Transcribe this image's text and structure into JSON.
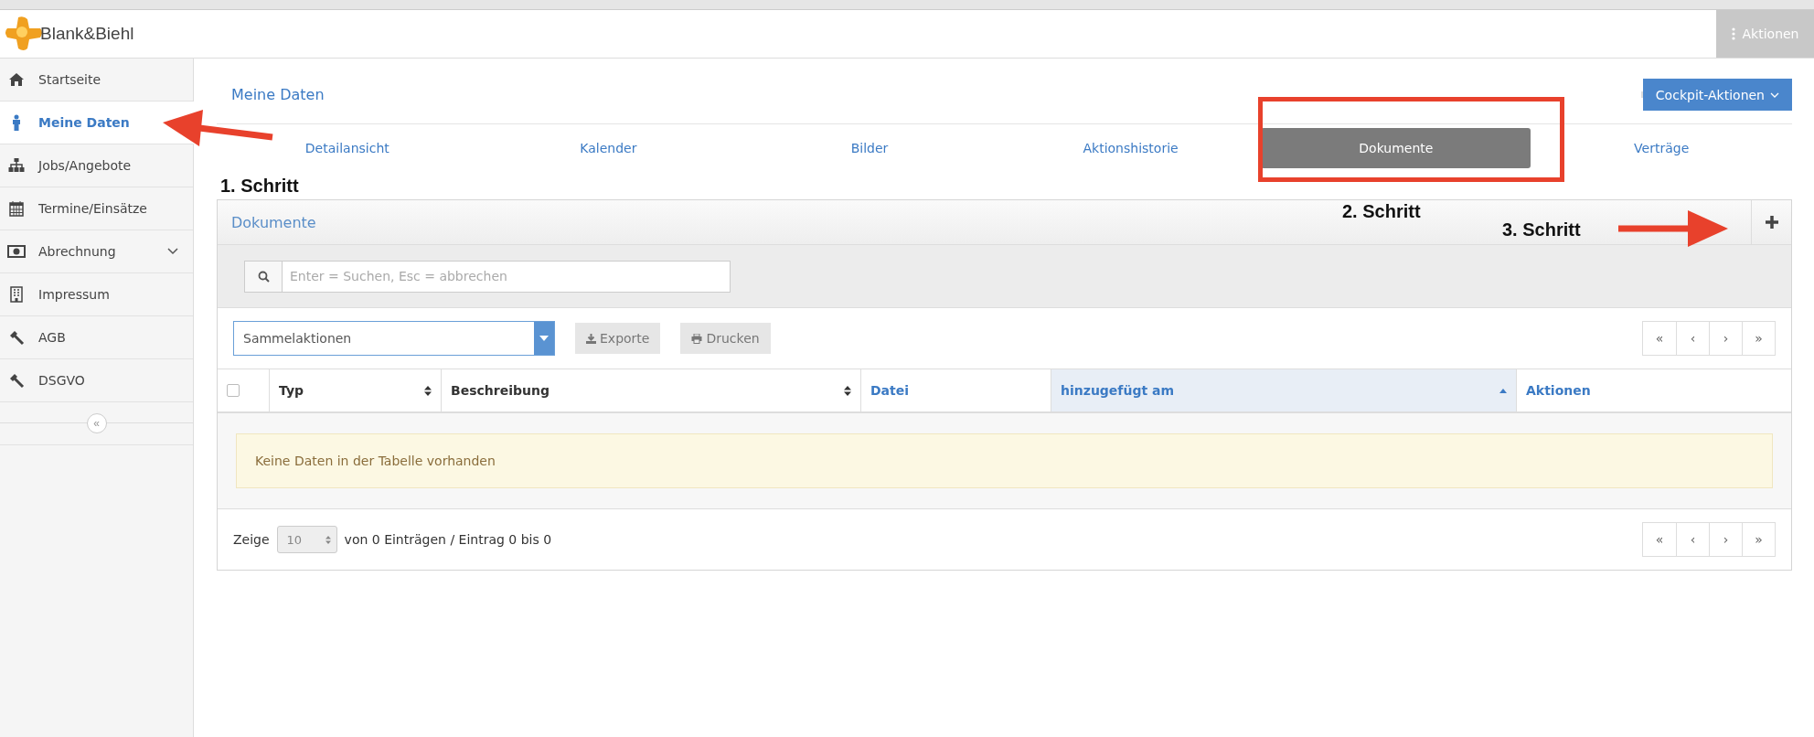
{
  "app": {
    "logo": "Blank&Biehl",
    "actions_button": "Aktionen"
  },
  "sidebar": {
    "items": [
      {
        "label": "Startseite",
        "selected": false,
        "submenu": false
      },
      {
        "label": "Meine Daten",
        "selected": true,
        "submenu": false
      },
      {
        "label": "Jobs/Angebote",
        "selected": false,
        "submenu": false
      },
      {
        "label": "Termine/Einsätze",
        "selected": false,
        "submenu": false
      },
      {
        "label": "Abrechnung",
        "selected": false,
        "submenu": true
      },
      {
        "label": "Impressum",
        "selected": false,
        "submenu": false
      },
      {
        "label": "AGB",
        "selected": false,
        "submenu": false
      },
      {
        "label": "DSGVO",
        "selected": false,
        "submenu": false
      }
    ],
    "collapse": "«"
  },
  "page": {
    "title": "Meine Daten",
    "cockpit_button": "Cockpit-Aktionen",
    "tabs": [
      {
        "label": "Detailansicht",
        "selected": false
      },
      {
        "label": "Kalender",
        "selected": false
      },
      {
        "label": "Bilder",
        "selected": false
      },
      {
        "label": "Aktionshistorie",
        "selected": false
      },
      {
        "label": "Dokumente",
        "selected": true
      },
      {
        "label": "Verträge",
        "selected": false
      }
    ]
  },
  "panel": {
    "title": "Dokumente",
    "search": {
      "placeholder": "Enter = Suchen, Esc = abbrechen"
    },
    "bulk_select": {
      "value": "Sammelaktionen"
    },
    "buttons": [
      "Exporte",
      "Drucken"
    ],
    "pager": [
      "«",
      "‹",
      "›",
      "»"
    ],
    "table": {
      "columns": [
        {
          "label": "Typ",
          "sortable": true,
          "sorted": false,
          "link": false
        },
        {
          "label": "Beschreibung",
          "sortable": true,
          "sorted": false,
          "link": false
        },
        {
          "label": "Datei",
          "sortable": false,
          "sorted": false,
          "link": true
        },
        {
          "label": "hinzugefügt am",
          "sortable": false,
          "sorted": true,
          "link": true
        },
        {
          "label": "Aktionen",
          "sortable": false,
          "sorted": false,
          "link": true
        }
      ],
      "select_all_checked": false,
      "empty_message": "Keine Daten in der Tabelle vorhanden"
    },
    "footer": {
      "show_label": "Zeige",
      "page_size": "10",
      "info": "von 0 Einträgen / Eintrag 0 bis 0",
      "pager": [
        "«",
        "‹",
        "›",
        "»"
      ]
    }
  },
  "annotations": [
    {
      "text": "1. Schritt"
    },
    {
      "text": "2. Schritt"
    },
    {
      "text": "3. Schritt"
    }
  ]
}
